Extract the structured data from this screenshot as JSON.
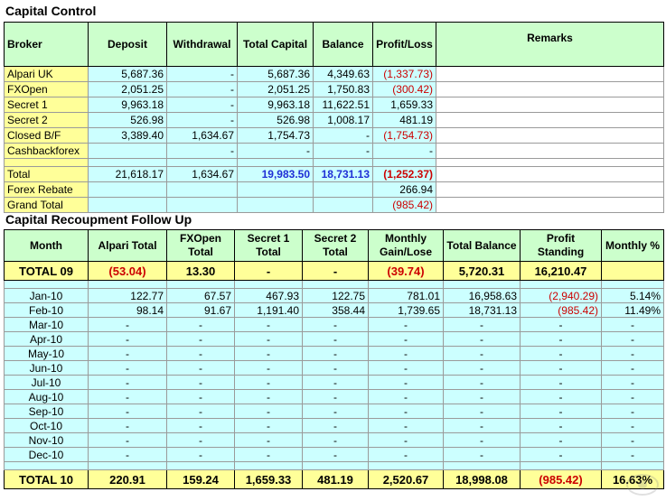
{
  "capital_control": {
    "title": "Capital Control",
    "headers": [
      "Broker",
      "Deposit",
      "Withdrawal",
      "Total Capital",
      "Balance",
      "Profit/Loss",
      "Remarks"
    ],
    "rows": [
      {
        "broker": "Alpari UK",
        "deposit": "5,687.36",
        "withdrawal": "-",
        "total_capital": "5,687.36",
        "balance": "4,349.63",
        "profit_loss": "(1,337.73)"
      },
      {
        "broker": "FXOpen",
        "deposit": "2,051.25",
        "withdrawal": "-",
        "total_capital": "2,051.25",
        "balance": "1,750.83",
        "profit_loss": "(300.42)"
      },
      {
        "broker": "Secret 1",
        "deposit": "9,963.18",
        "withdrawal": "-",
        "total_capital": "9,963.18",
        "balance": "11,622.51",
        "profit_loss": "1,659.33"
      },
      {
        "broker": "Secret 2",
        "deposit": "526.98",
        "withdrawal": "-",
        "total_capital": "526.98",
        "balance": "1,008.17",
        "profit_loss": "481.19"
      },
      {
        "broker": "Closed B/F",
        "deposit": "3,389.40",
        "withdrawal": "1,634.67",
        "total_capital": "1,754.73",
        "balance": "-",
        "profit_loss": "(1,754.73)"
      },
      {
        "broker": "Cashbackforex",
        "deposit": "",
        "withdrawal": "-",
        "total_capital": "-",
        "balance": "-",
        "profit_loss": "-"
      }
    ],
    "total": {
      "label": "Total",
      "deposit": "21,618.17",
      "withdrawal": "1,634.67",
      "total_capital": "19,983.50",
      "balance": "18,731.13",
      "profit_loss": "(1,252.37)"
    },
    "rebate": {
      "label": "Forex Rebate",
      "profit_loss": "266.94"
    },
    "grand_total": {
      "label": "Grand Total",
      "profit_loss": "(985.42)"
    }
  },
  "recoupment": {
    "title": "Capital Recoupment Follow Up",
    "headers": [
      "Month",
      "Alpari Total",
      "FXOpen Total",
      "Secret 1 Total",
      "Secret 2 Total",
      "Monthly Gain/Lose",
      "Total Balance",
      "Profit Standing",
      "Monthly %"
    ],
    "total_09": {
      "label": "TOTAL 09",
      "alpari": "(53.04)",
      "fxopen": "13.30",
      "secret1": "-",
      "secret2": "-",
      "gain": "(39.74)",
      "balance": "5,720.31",
      "standing": "16,210.47",
      "pct": ""
    },
    "months": [
      {
        "month": "Jan-10",
        "alpari": "122.77",
        "fxopen": "67.57",
        "secret1": "467.93",
        "secret2": "122.75",
        "gain": "781.01",
        "balance": "16,958.63",
        "standing": "(2,940.29)",
        "pct": "5.14%"
      },
      {
        "month": "Feb-10",
        "alpari": "98.14",
        "fxopen": "91.67",
        "secret1": "1,191.40",
        "secret2": "358.44",
        "gain": "1,739.65",
        "balance": "18,731.13",
        "standing": "(985.42)",
        "pct": "11.49%"
      },
      {
        "month": "Mar-10",
        "alpari": "-",
        "fxopen": "-",
        "secret1": "-",
        "secret2": "-",
        "gain": "-",
        "balance": "-",
        "standing": "-",
        "pct": "-"
      },
      {
        "month": "Apr-10",
        "alpari": "-",
        "fxopen": "-",
        "secret1": "-",
        "secret2": "-",
        "gain": "-",
        "balance": "-",
        "standing": "-",
        "pct": "-"
      },
      {
        "month": "May-10",
        "alpari": "-",
        "fxopen": "-",
        "secret1": "-",
        "secret2": "-",
        "gain": "-",
        "balance": "-",
        "standing": "-",
        "pct": "-"
      },
      {
        "month": "Jun-10",
        "alpari": "-",
        "fxopen": "-",
        "secret1": "-",
        "secret2": "-",
        "gain": "-",
        "balance": "-",
        "standing": "-",
        "pct": "-"
      },
      {
        "month": "Jul-10",
        "alpari": "-",
        "fxopen": "-",
        "secret1": "-",
        "secret2": "-",
        "gain": "-",
        "balance": "-",
        "standing": "-",
        "pct": "-"
      },
      {
        "month": "Aug-10",
        "alpari": "-",
        "fxopen": "-",
        "secret1": "-",
        "secret2": "-",
        "gain": "-",
        "balance": "-",
        "standing": "-",
        "pct": "-"
      },
      {
        "month": "Sep-10",
        "alpari": "-",
        "fxopen": "-",
        "secret1": "-",
        "secret2": "-",
        "gain": "-",
        "balance": "-",
        "standing": "-",
        "pct": "-"
      },
      {
        "month": "Oct-10",
        "alpari": "-",
        "fxopen": "-",
        "secret1": "-",
        "secret2": "-",
        "gain": "-",
        "balance": "-",
        "standing": "-",
        "pct": "-"
      },
      {
        "month": "Nov-10",
        "alpari": "-",
        "fxopen": "-",
        "secret1": "-",
        "secret2": "-",
        "gain": "-",
        "balance": "-",
        "standing": "-",
        "pct": "-"
      },
      {
        "month": "Dec-10",
        "alpari": "-",
        "fxopen": "-",
        "secret1": "-",
        "secret2": "-",
        "gain": "-",
        "balance": "-",
        "standing": "-",
        "pct": "-"
      }
    ],
    "total_10": {
      "label": "TOTAL 10",
      "alpari": "220.91",
      "fxopen": "159.24",
      "secret1": "1,659.33",
      "secret2": "481.19",
      "gain": "2,520.67",
      "balance": "18,998.08",
      "standing": "(985.42)",
      "pct": "16.63%"
    }
  },
  "colors": {
    "header_bg": "#ccffcc",
    "label_bg": "#ffff99",
    "cell_bg": "#ccffff",
    "negative": "#cc0000",
    "highlight": "#1f2fd6"
  }
}
